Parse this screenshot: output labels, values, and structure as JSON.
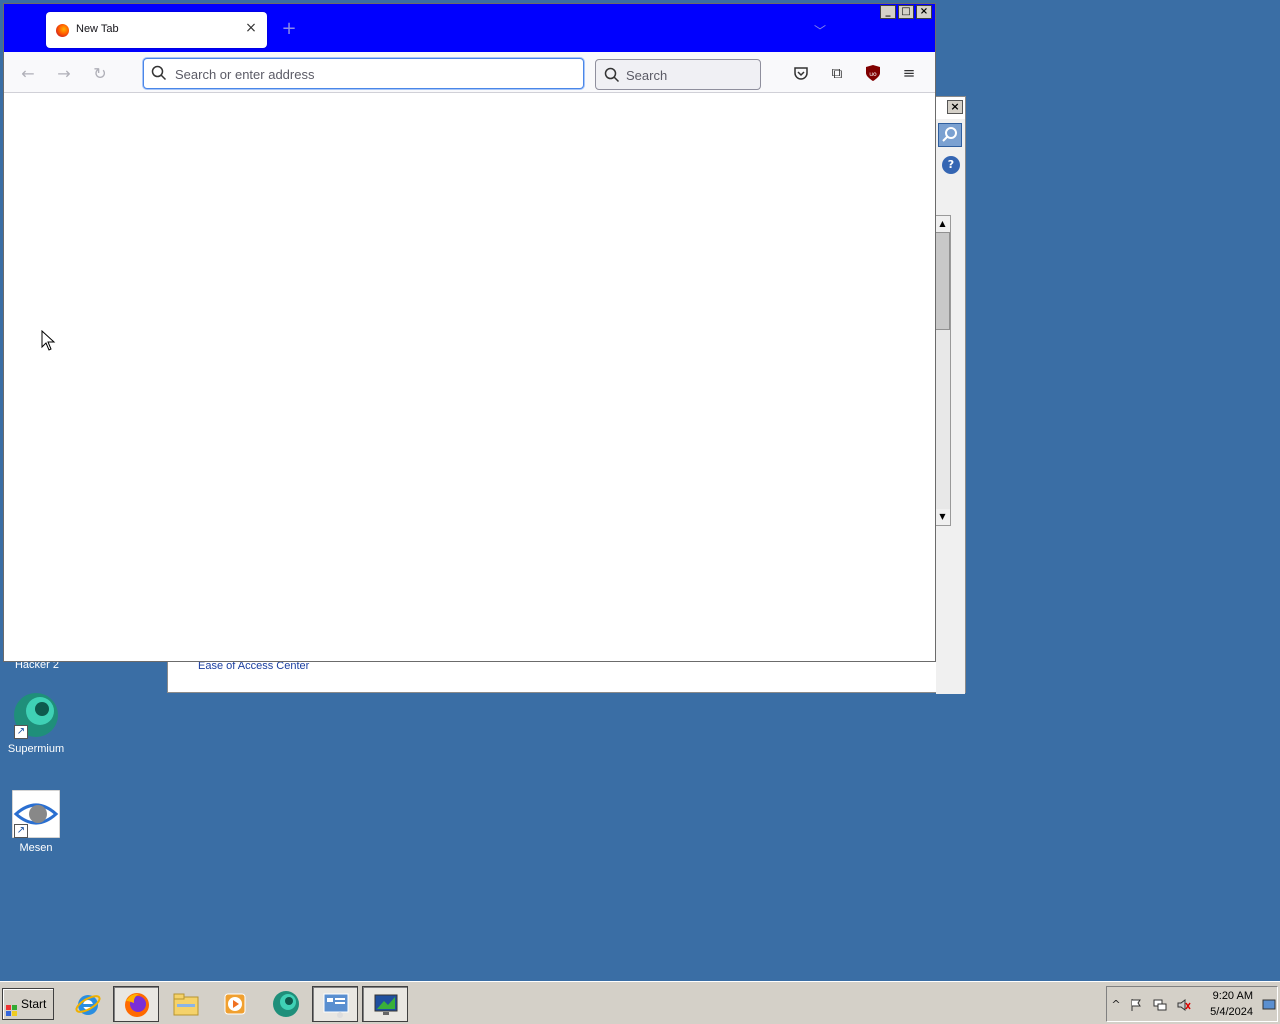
{
  "firefox": {
    "tab_title": "New Tab",
    "tab_close_icon": "×",
    "new_tab_icon": "+",
    "list_tabs_icon": "﹀",
    "url_placeholder": "Search or enter address",
    "search_placeholder": "Search",
    "back_icon": "←",
    "forward_icon": "→",
    "reload_icon": "↻",
    "extensions_icon": "⧉",
    "menu_icon": "≡",
    "titlebar_color": "#0000ff",
    "window_buttons": {
      "minimize": "_",
      "maximize": "□",
      "close": "×"
    }
  },
  "control_panel": {
    "close_label": "×",
    "help_label": "?",
    "link_text": "Ease of Access Center",
    "scroll_up": "▲",
    "scroll_down": "▼"
  },
  "desktop": {
    "icons": [
      {
        "label": "Hacker 2",
        "icon": "app-icon"
      },
      {
        "label": "Supermium",
        "icon": "supermium-icon"
      },
      {
        "label": "Mesen",
        "icon": "mesen-icon"
      }
    ],
    "background_color": "#3a6ea5"
  },
  "taskbar": {
    "start_label": "Start",
    "apps": [
      {
        "name": "Internet Explorer",
        "icon": "ie-icon"
      },
      {
        "name": "Firefox",
        "icon": "firefox-icon",
        "active": true
      },
      {
        "name": "File Explorer",
        "icon": "folder-icon"
      },
      {
        "name": "Media Player",
        "icon": "media-player-icon"
      },
      {
        "name": "Supermium",
        "icon": "supermium-icon"
      },
      {
        "name": "Control Panel",
        "icon": "control-panel-icon"
      },
      {
        "name": "Remote Desktop",
        "icon": "monitor-icon"
      }
    ],
    "tray": {
      "expand_icon": "^",
      "time": "9:20 AM",
      "date": "5/4/2024"
    }
  }
}
